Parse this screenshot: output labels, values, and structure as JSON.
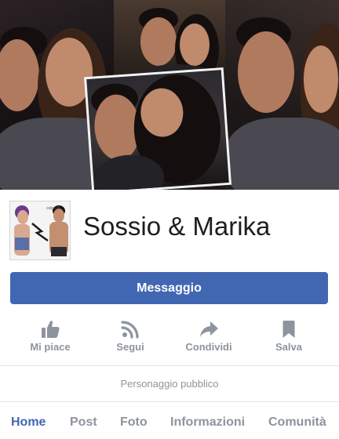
{
  "page": {
    "name": "Sossio & Marika",
    "category": "Personaggio pubblico"
  },
  "profile_picture": {
    "caption": "colpo di"
  },
  "message_button": {
    "label": "Messaggio"
  },
  "actions": [
    {
      "label": "Mi piace",
      "icon": "thumbs-up-icon"
    },
    {
      "label": "Segui",
      "icon": "rss-feed-icon"
    },
    {
      "label": "Condividi",
      "icon": "share-arrow-icon"
    },
    {
      "label": "Salva",
      "icon": "bookmark-icon"
    }
  ],
  "tabs": [
    {
      "label": "Home",
      "active": true
    },
    {
      "label": "Post",
      "active": false
    },
    {
      "label": "Foto",
      "active": false
    },
    {
      "label": "Informazioni",
      "active": false
    },
    {
      "label": "Comunità",
      "active": false
    }
  ],
  "colors": {
    "accent": "#4267b2",
    "muted_text": "#8d949e",
    "divider": "#e3e4e8"
  }
}
